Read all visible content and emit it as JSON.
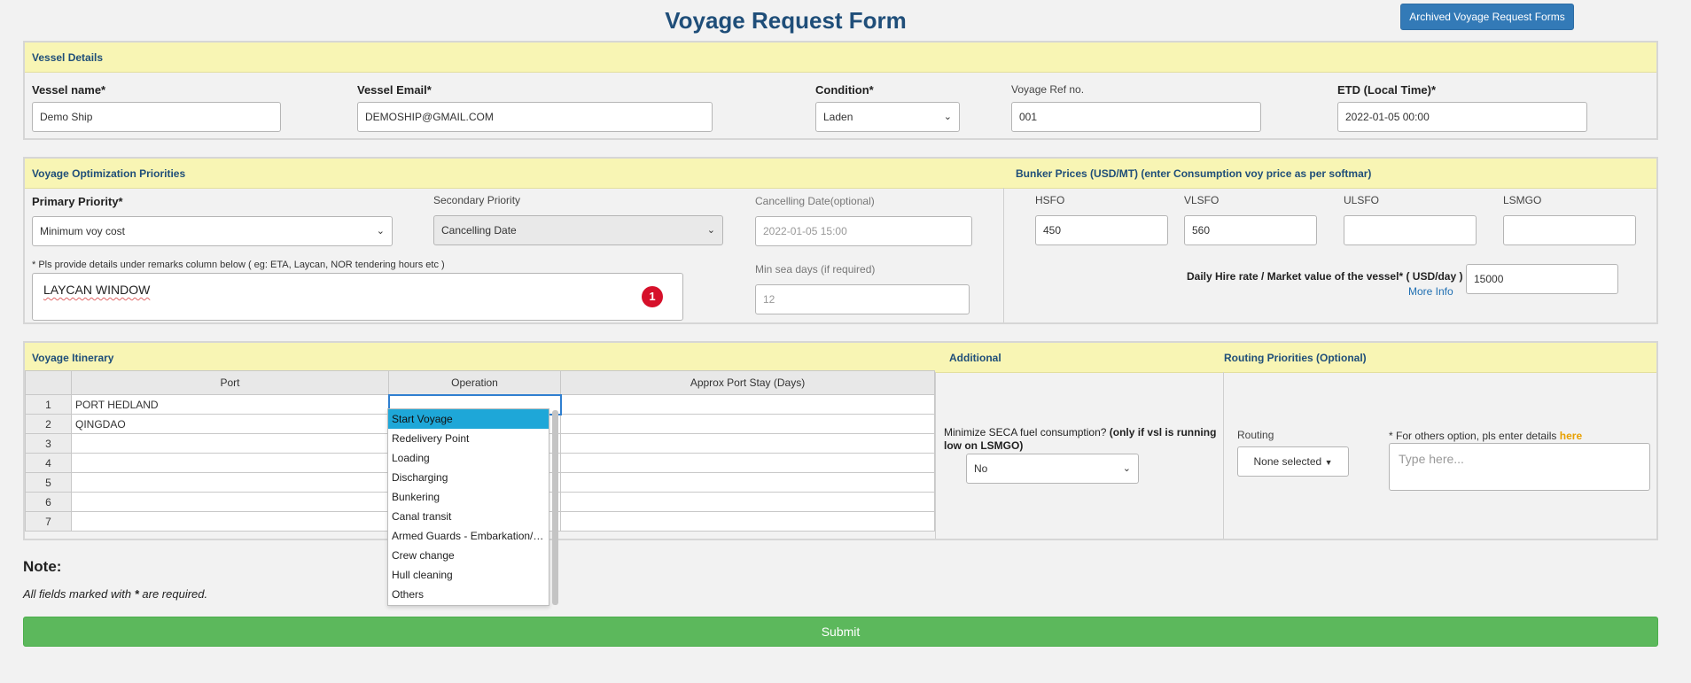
{
  "header": {
    "title": "Voyage Request Form",
    "archived_button": "Archived Voyage Request Forms"
  },
  "vessel": {
    "section": "Vessel Details",
    "name_label": "Vessel name*",
    "name_value": "Demo Ship",
    "email_label": "Vessel Email*",
    "email_value": "DEMOSHIP@GMAIL.COM",
    "condition_label": "Condition*",
    "condition_value": "Laden",
    "ref_label": "Voyage Ref no.",
    "ref_value": "001",
    "etd_label": "ETD (Local Time)*",
    "etd_value": "2022-01-05 00:00"
  },
  "priorities": {
    "section": "Voyage Optimization Priorities",
    "primary_label": "Primary Priority*",
    "primary_value": "Minimum voy cost",
    "secondary_label": "Secondary Priority",
    "secondary_value": "Cancelling Date",
    "cancelling_label": "Cancelling Date(optional)",
    "cancelling_value": "2022-01-05 15:00",
    "remarks_hint": "* Pls provide details under remarks column below ( eg: ETA, Laycan, NOR tendering hours etc )",
    "remarks_value": "LAYCAN WINDOW",
    "badge": "1",
    "min_sea_label": "Min sea days (if required)",
    "min_sea_value": "12"
  },
  "bunker": {
    "section": "Bunker Prices (USD/MT) (enter Consumption voy price as per softmar)",
    "hsfo_label": "HSFO",
    "hsfo_value": "450",
    "vlsfo_label": "VLSFO",
    "vlsfo_value": "560",
    "ulsfo_label": "ULSFO",
    "ulsfo_value": "",
    "lsmgo_label": "LSMGO",
    "lsmgo_value": "",
    "hire_label": "Daily Hire rate / Market value of the vessel* ( USD/day )",
    "hire_value": "15000",
    "more_info": "More Info"
  },
  "itinerary": {
    "section": "Voyage Itinerary",
    "columns": [
      "Port",
      "Operation",
      "Approx Port Stay (Days)"
    ],
    "rows": [
      {
        "n": "1",
        "port": "PORT HEDLAND"
      },
      {
        "n": "2",
        "port": "QINGDAO"
      },
      {
        "n": "3",
        "port": ""
      },
      {
        "n": "4",
        "port": ""
      },
      {
        "n": "5",
        "port": ""
      },
      {
        "n": "6",
        "port": ""
      },
      {
        "n": "7",
        "port": ""
      }
    ],
    "operation_options": [
      "Start Voyage",
      "Redelivery Point",
      "Loading",
      "Discharging",
      "Bunkering",
      "Canal transit",
      "Armed Guards - Embarkation/…",
      "Crew change",
      "Hull cleaning",
      "Others"
    ]
  },
  "additional": {
    "section": "Additional",
    "seca_label_a": "Minimize SECA fuel consumption? ",
    "seca_label_b": "(only if vsl is running low on LSMGO)",
    "seca_value": "No"
  },
  "routing": {
    "section": "Routing Priorities (Optional)",
    "routing_label": "Routing",
    "routing_value": "None selected",
    "others_label": "* For others option, pls enter details ",
    "others_link": "here",
    "others_placeholder": "Type here..."
  },
  "note": {
    "title": "Note:",
    "text_a": "All fields marked with ",
    "text_b": "*",
    "text_c": " are required."
  },
  "submit": "Submit"
}
